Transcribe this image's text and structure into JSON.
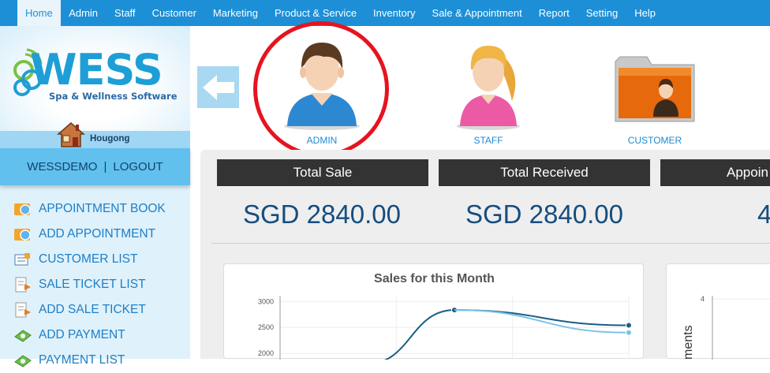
{
  "nav": {
    "items": [
      {
        "label": "Home",
        "active": true
      },
      {
        "label": "Admin"
      },
      {
        "label": "Staff"
      },
      {
        "label": "Customer"
      },
      {
        "label": "Marketing"
      },
      {
        "label": "Product & Service"
      },
      {
        "label": "Inventory"
      },
      {
        "label": "Sale & Appointment"
      },
      {
        "label": "Report"
      },
      {
        "label": "Setting"
      },
      {
        "label": "Help"
      }
    ]
  },
  "brand": {
    "name": "WESS",
    "tagline": "Spa & Wellness Software",
    "branch": "Hougong",
    "color_primary": "#1e9ed6",
    "color_nav": "#1d8fd6"
  },
  "user": {
    "username": "WESSDEMO",
    "separator": "|",
    "logout": "LOGOUT"
  },
  "menu": [
    {
      "label": "APPOINTMENT BOOK",
      "icon": "appointment-book-icon"
    },
    {
      "label": "ADD APPOINTMENT",
      "icon": "add-appointment-icon"
    },
    {
      "label": "CUSTOMER LIST",
      "icon": "customer-list-icon"
    },
    {
      "label": "SALE TICKET LIST",
      "icon": "sale-ticket-list-icon"
    },
    {
      "label": "ADD SALE TICKET",
      "icon": "add-sale-ticket-icon"
    },
    {
      "label": "ADD PAYMENT",
      "icon": "add-payment-icon"
    },
    {
      "label": "PAYMENT LIST",
      "icon": "payment-list-icon"
    }
  ],
  "quick_links": [
    {
      "label": "ADMIN",
      "icon": "admin-avatar-icon",
      "highlighted": true
    },
    {
      "label": "STAFF",
      "icon": "staff-avatar-icon"
    },
    {
      "label": "CUSTOMER",
      "icon": "customer-folder-icon"
    }
  ],
  "stats": [
    {
      "label": "Total Sale",
      "value": "SGD 2840.00"
    },
    {
      "label": "Total Received",
      "value": "SGD 2840.00"
    },
    {
      "label": "Appoin",
      "value": "4"
    }
  ],
  "chart_data": [
    {
      "type": "line",
      "title": "Sales for this Month",
      "y_ticks": [
        3000,
        2500,
        2000
      ],
      "ylim": [
        1850,
        3080
      ],
      "grid": true,
      "series": [
        {
          "color": "#1a5e86",
          "points": [
            [
              0.0,
              1700
            ],
            [
              0.25,
              1800
            ],
            [
              0.5,
              2835
            ],
            [
              1.0,
              2540
            ]
          ]
        },
        {
          "color": "#7cc2e6",
          "points": [
            [
              0.5,
              2835
            ],
            [
              1.0,
              2400
            ]
          ]
        }
      ]
    },
    {
      "type": "bar",
      "title": "",
      "ylabel": "ments",
      "y_ticks": [
        4
      ]
    }
  ]
}
